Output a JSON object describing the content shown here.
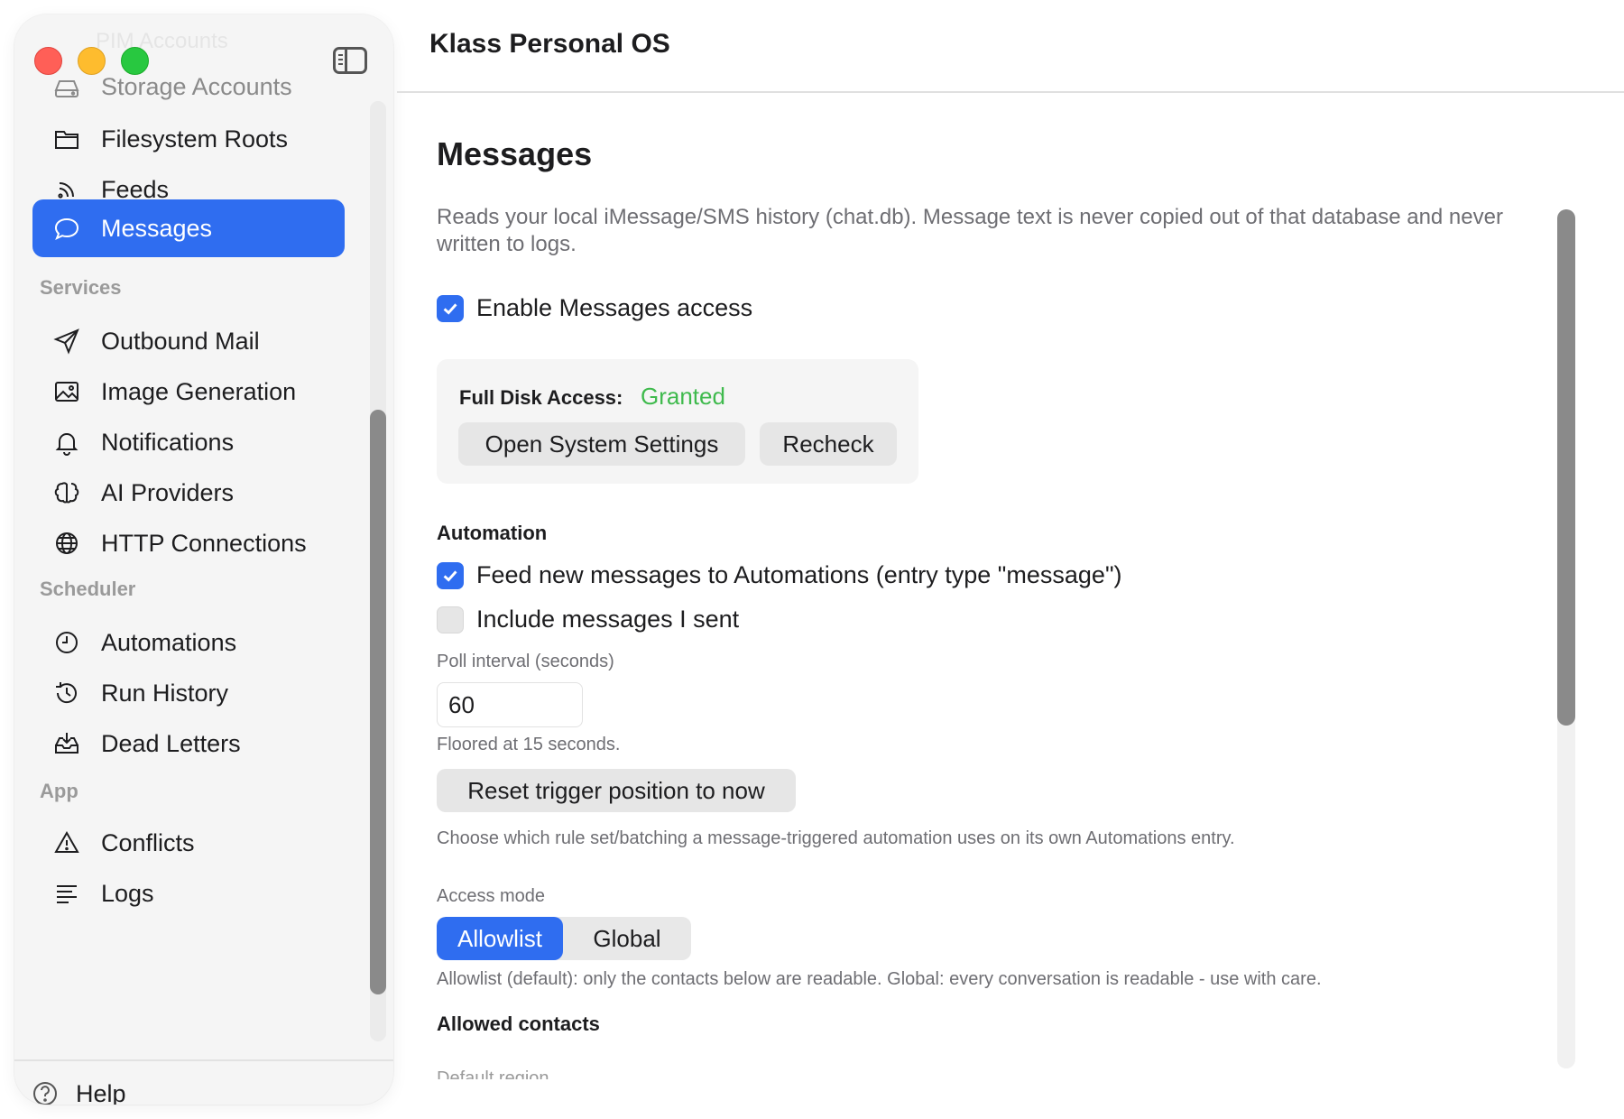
{
  "window": {
    "title": "Klass Personal OS"
  },
  "sidebar": {
    "ghost_item": "PIM Accounts",
    "items_top": [
      {
        "label": "Storage Accounts",
        "icon": "storage-icon"
      },
      {
        "label": "Filesystem Roots",
        "icon": "folder-icon"
      },
      {
        "label": "Feeds",
        "icon": "rss-icon"
      },
      {
        "label": "Messages",
        "icon": "chat-bubble-icon",
        "active": true
      }
    ],
    "sections": {
      "services": "Services",
      "scheduler": "Scheduler",
      "app": "App"
    },
    "services_items": [
      {
        "label": "Outbound Mail",
        "icon": "paper-plane-icon"
      },
      {
        "label": "Image Generation",
        "icon": "image-icon"
      },
      {
        "label": "Notifications",
        "icon": "bell-icon"
      },
      {
        "label": "AI Providers",
        "icon": "brain-icon"
      },
      {
        "label": "HTTP Connections",
        "icon": "globe-icon"
      }
    ],
    "scheduler_items": [
      {
        "label": "Automations",
        "icon": "clock-icon"
      },
      {
        "label": "Run History",
        "icon": "history-icon"
      },
      {
        "label": "Dead Letters",
        "icon": "inbox-tray-icon"
      }
    ],
    "app_items": [
      {
        "label": "Conflicts",
        "icon": "warning-icon"
      },
      {
        "label": "Logs",
        "icon": "lines-icon"
      }
    ],
    "help_label": "Help"
  },
  "main": {
    "title": "Messages",
    "description": "Reads your local iMessage/SMS history (chat.db). Message text is never copied out of that database and never written to logs.",
    "enable_access": {
      "label": "Enable Messages access",
      "checked": true
    },
    "full_disk_access": {
      "label": "Full Disk Access:",
      "status": "Granted",
      "status_color": "#3fba4d",
      "open_settings_label": "Open System Settings",
      "recheck_label": "Recheck"
    },
    "automation": {
      "heading": "Automation",
      "feed_new": {
        "label": "Feed new messages to Automations (entry type \"message\")",
        "checked": true
      },
      "include_sent": {
        "label": "Include messages I sent",
        "checked": false
      },
      "poll_interval_label": "Poll interval (seconds)",
      "poll_interval_value": "60",
      "poll_hint": "Floored at 15 seconds.",
      "reset_label": "Reset trigger position to now",
      "reset_hint": "Choose which rule set/batching a message-triggered automation uses on its own Automations entry."
    },
    "access_mode": {
      "label": "Access mode",
      "options": [
        "Allowlist",
        "Global"
      ],
      "selected": "Allowlist",
      "hint": "Allowlist (default): only the contacts below are readable. Global: every conversation is readable - use with care."
    },
    "allowed_contacts": {
      "heading": "Allowed contacts",
      "cut_label": "Default region"
    }
  },
  "colors": {
    "accent": "#2f6df0",
    "granted": "#3fba4d"
  }
}
